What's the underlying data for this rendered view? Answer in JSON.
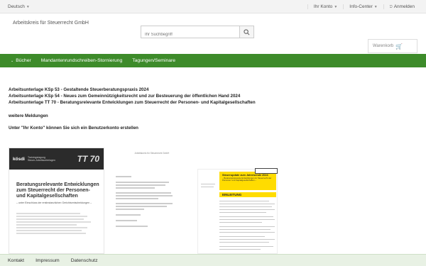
{
  "topbar": {
    "language": "Deutsch",
    "account": "Ihr Konto",
    "info_center": "Info-Center",
    "login": "Anmelden"
  },
  "header": {
    "company": "Arbeitskreis für Steuerrecht GmbH",
    "search_placeholder": "Ihr Suchbegriff",
    "cart_label": "Warenkorb"
  },
  "nav": {
    "items": [
      "Bücher",
      "Mandantenrundschreiben-Stornierung",
      "Tagungen/Seminare"
    ]
  },
  "news": {
    "items": [
      "Arbeitsunterlage KSp 53 -  Gestaltende Steuerberatungspraxis 2024",
      "Arbeitsunterlage KSp 54 - Neues zum Gemeinnützigkeitsrecht und zur Besteuerung der öffentlichen Hand 2024",
      "Arbeitsunterlage TT 70 - Beratungsrelevante Entwicklungen zum Steuerrecht der Personen- und Kapitalgesellschaften"
    ],
    "more": "weitere Meldungen",
    "account_hint": "Unter \"Ihr Konto\" können Sie sich ein Benutzerkonto erstellen"
  },
  "thumb1": {
    "brand": "kösdi",
    "brand_sub": "Trainingstagung\nSteuer-Arbeitsunterlagen",
    "code": "TT 70",
    "title": "Beratungsrelevante Entwicklungen zum Steuerrecht der Personen- und Kapitalgesellschaften",
    "subtitle": "– unter Einschluss der erstinstanzlichen Gerichtsentscheidungen –"
  },
  "thumb2": {
    "header": "Arbeitskreis für Steuerrecht GmbH"
  },
  "thumb3": {
    "box_title": "Steuerupdate zum Jahresende 2024",
    "box_sub": "– Beratungsrelevante Entwicklungen im Steuerrecht der Personen- und Kapitalgesellschaften –",
    "section": "EINLEITUNG"
  },
  "footer": {
    "items": [
      "Kontakt",
      "Impressum",
      "Datenschutz"
    ]
  },
  "colors": {
    "nav_green": "#3d8b2a",
    "footer_bg": "#e8f1e4",
    "highlight_yellow": "#ffdc00"
  }
}
